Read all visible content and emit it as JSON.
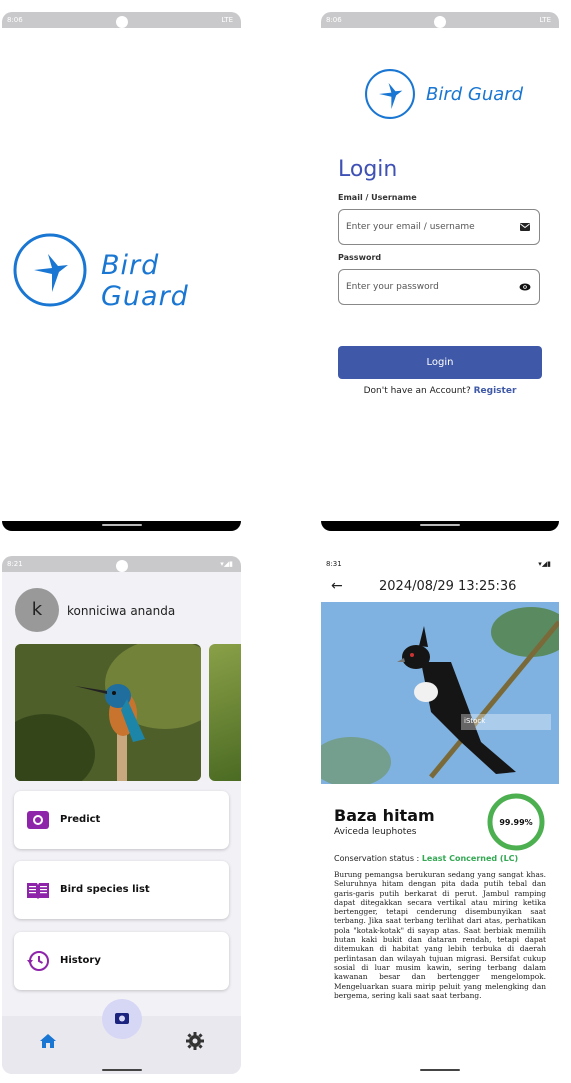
{
  "splash": {
    "status_time": "8:06",
    "status_signal": "LTE",
    "app_name": "Bird Guard"
  },
  "login": {
    "status_time": "8:06",
    "status_signal": "LTE",
    "app_name": "Bird Guard",
    "title": "Login",
    "email_label": "Email / Username",
    "email_placeholder": "Enter your email / username",
    "password_label": "Password",
    "password_placeholder": "Enter your password",
    "login_button": "Login",
    "no_account_text": "Don't have an Account?",
    "register_link": "Register"
  },
  "home": {
    "status_time": "8:21",
    "avatar_letter": "k",
    "username": "konniciwa ananda",
    "menu": [
      {
        "label": "Predict",
        "icon": "camera-icon"
      },
      {
        "label": "Bird species list",
        "icon": "book-icon"
      },
      {
        "label": "History",
        "icon": "history-icon"
      }
    ],
    "nav": [
      "home-icon",
      "camera-icon",
      "gear-icon"
    ]
  },
  "detail": {
    "status_time": "8:31",
    "datetime": "2024/08/29 13:25:36",
    "watermark": "iStock",
    "bird_name": "Baza hitam",
    "scientific_name": "Aviceda leuphotes",
    "confidence": "99.99%",
    "confidence_value": 0.9999,
    "conservation_label": "Conservation status :",
    "conservation_value": "Least Concerned (LC)",
    "description": "Burung pemangsa berukuran sedang yang sangat khas. Seluruhnya hitam dengan pita dada putih tebal dan garis-garis putih berkarat di perut. Jambul ramping dapat ditegakkan secara vertikal atau miring ketika bertengger, tetapi cenderung disembunyikan saat terbang. Jika saat terbang terlihat dari atas, perhatikan pola \"kotak-kotak\" di sayap atas. Saat berbiak memilih hutan kaki bukit dan dataran rendah, tetapi dapat ditemukan di habitat yang lebih terbuka di daerah perlintasan dan wilayah tujuan migrasi. Bersifat cukup sosial di luar musim kawin, sering terbang dalam kawanan besar dan bertengger mengelompok. Mengeluarkan suara mirip peluit yang melengking dan bergema, sering kali saat saat terbang."
  },
  "colors": {
    "brand_blue": "#1976d2",
    "button": "#3f59a8",
    "accent_purple": "#8e24aa",
    "success": "#34a853"
  }
}
